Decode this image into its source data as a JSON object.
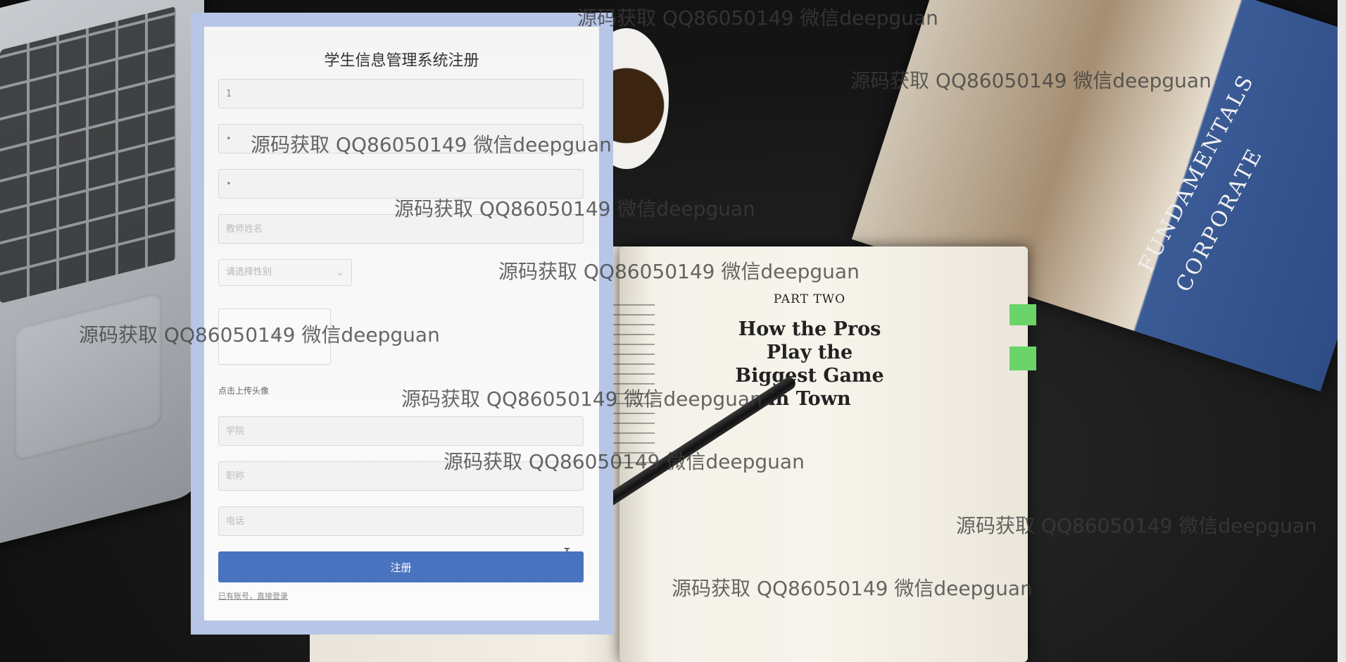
{
  "form": {
    "title": "学生信息管理系统注册",
    "username": {
      "value": "1"
    },
    "password": {
      "value": "•"
    },
    "confirm_password": {
      "value": "•"
    },
    "teacher_name": {
      "placeholder": "教师姓名"
    },
    "gender": {
      "placeholder": "请选择性别"
    },
    "avatar_upload_label": "点击上传头像",
    "college": {
      "placeholder": "学院"
    },
    "title_rank": {
      "placeholder": "职称"
    },
    "phone": {
      "placeholder": "电话"
    },
    "register_button": "注册",
    "login_link": "已有账号，直接登录"
  },
  "background_book": {
    "part": "PART TWO",
    "title_lines": [
      "How the Pros",
      "Play the",
      "Biggest Game",
      "in Town"
    ],
    "cover_title_lines": [
      "FUNDAMENTALS",
      "CORPORATE"
    ]
  },
  "watermark": "源码获取 QQ86050149 微信deepguan",
  "colors": {
    "accent": "#4a73bf",
    "panel_frame": "#b7c6e6"
  }
}
